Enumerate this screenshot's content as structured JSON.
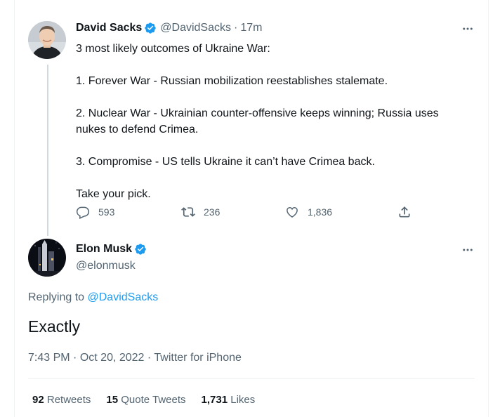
{
  "original_tweet": {
    "author_name": "David Sacks",
    "author_handle": "@DavidSacks",
    "separator": "·",
    "time_ago": "17m",
    "more_icon": "more-horizontal-icon",
    "lines": [
      "3 most likely outcomes of Ukraine War:",
      "",
      "1. Forever War - Russian mobilization reestablishes stalemate.",
      "",
      "2. Nuclear War - Ukrainian counter-offensive keeps winning; Russia uses",
      "nukes to defend Crimea.",
      "",
      "3. Compromise - US tells Ukraine it can’t have Crimea back.",
      "",
      "Take your pick."
    ],
    "actions": {
      "replies": "593",
      "retweets": "236",
      "likes": "1,836"
    }
  },
  "reply_tweet": {
    "author_name": "Elon Musk",
    "author_handle": "@elonmusk",
    "replying_prefix": "Replying to",
    "replying_to": "@DavidSacks",
    "text": "Exactly",
    "time": "7:43 PM",
    "separator": "·",
    "date": "Oct 20, 2022",
    "source": "Twitter for iPhone",
    "stats": {
      "retweets_count": "92",
      "retweets_label": "Retweets",
      "quotes_count": "15",
      "quotes_label": "Quote Tweets",
      "likes_count": "1,731",
      "likes_label": "Likes"
    }
  },
  "colors": {
    "accent": "#1d9bf0",
    "text_primary": "#0f1419",
    "text_secondary": "#536471",
    "thread_line": "#cfd9de",
    "divider": "#eff3f4"
  }
}
